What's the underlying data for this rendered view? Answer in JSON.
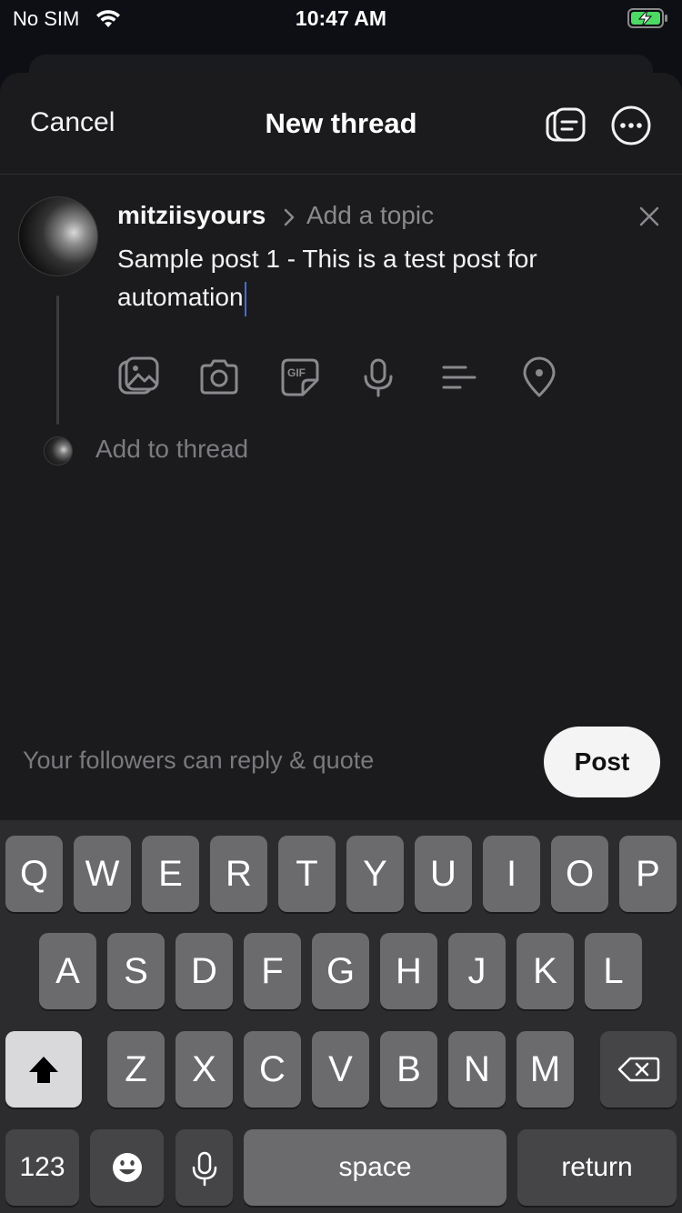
{
  "status": {
    "carrier": "No SIM",
    "time": "10:47 AM"
  },
  "nav": {
    "cancel_label": "Cancel",
    "title": "New thread"
  },
  "compose": {
    "username": "mitziisyours",
    "topic_placeholder": "Add a topic",
    "text": "Sample post 1 - This is a test post for automation",
    "add_to_thread": "Add to thread"
  },
  "footer": {
    "reply_permission": "Your followers can reply & quote",
    "post_label": "Post"
  },
  "keyboard": {
    "row1": [
      "Q",
      "W",
      "E",
      "R",
      "T",
      "Y",
      "U",
      "I",
      "O",
      "P"
    ],
    "row2": [
      "A",
      "S",
      "D",
      "F",
      "G",
      "H",
      "J",
      "K",
      "L"
    ],
    "row3": [
      "Z",
      "X",
      "C",
      "V",
      "B",
      "N",
      "M"
    ],
    "numbers_label": "123",
    "space_label": "space",
    "return_label": "return"
  },
  "icons": [
    "wifi-icon",
    "battery-charging-icon",
    "drafts-icon",
    "more-icon",
    "close-icon",
    "gallery-icon",
    "camera-icon",
    "gif-icon",
    "microphone-icon",
    "poll-icon",
    "location-icon",
    "shift-icon",
    "backspace-icon",
    "emoji-icon",
    "dictation-icon"
  ],
  "colors": {
    "background": "#1b1b1d",
    "post_button": "#f4f4f4",
    "battery_green": "#4cd964",
    "caret": "#3f6fd8"
  }
}
